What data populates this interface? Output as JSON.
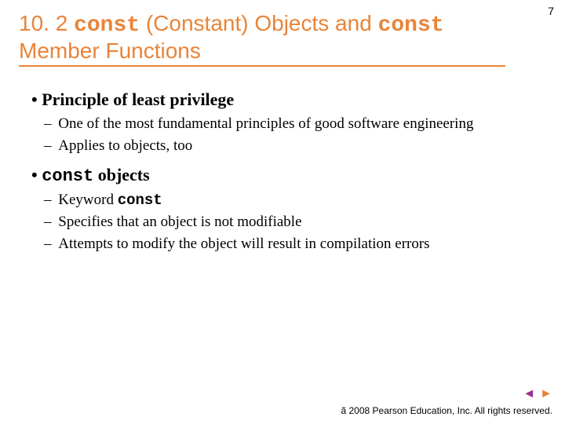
{
  "page_number": "7",
  "heading": {
    "section_no": "10. 2",
    "kw1": "const",
    "mid": " (Constant) Objects and ",
    "kw2": "const",
    "tail": " Member Functions"
  },
  "bullets": {
    "b1a": "Principle of least privilege",
    "b1a_subs": [
      "One of the most fundamental principles of good software engineering",
      "Applies to objects, too"
    ],
    "b1b_kw": "const",
    "b1b_tail": " objects",
    "b1b_subs_pre": "Keyword ",
    "b1b_subs_kw": "const",
    "b1b_subs_rest": [
      "Specifies that an object is not modifiable",
      "Attempts to modify the object will result in compilation errors"
    ]
  },
  "footer": "ã 2008 Pearson Education, Inc. All rights reserved.",
  "nav": {
    "prev": "◄",
    "next": "►"
  }
}
